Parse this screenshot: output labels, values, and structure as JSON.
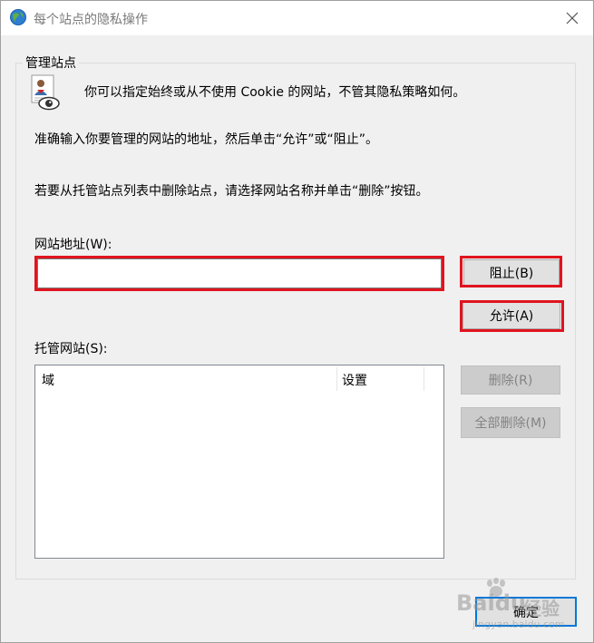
{
  "window": {
    "title": "每个站点的隐私操作"
  },
  "group": {
    "title": "管理站点",
    "intro": "你可以指定始终或从不使用 Cookie 的网站，不管其隐私策略如何。",
    "instruction1": "准确输入你要管理的网站的地址，然后单击“允许”或“阻止”。",
    "instruction2": "若要从托管站点列表中删除站点，请选择网站名称并单击“删除”按钮。"
  },
  "address": {
    "label": "网站地址(W):",
    "value": "",
    "placeholder": ""
  },
  "buttons": {
    "block": "阻止(B)",
    "allow": "允许(A)",
    "remove": "删除(R)",
    "remove_all": "全部删除(M)",
    "ok": "确定"
  },
  "managed": {
    "label": "托管网站(S):",
    "columns": [
      "域",
      "设置"
    ],
    "rows": []
  },
  "colors": {
    "highlight": "#e0141e",
    "accent": "#0078d7"
  },
  "watermark": {
    "brand": "Baidu",
    "sub": "经验",
    "url": "jingyan.baidu.com"
  }
}
